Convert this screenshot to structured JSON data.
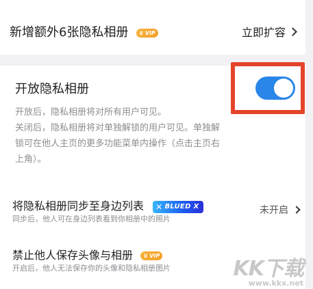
{
  "top_card": {
    "title": "新增额外6张隐私相册",
    "vip_badge": "VIP",
    "action_label": "立即扩容"
  },
  "private_album": {
    "title": "开放隐私相册",
    "toggle_on": true,
    "desc_lines": [
      "开放后，隐私相册将对所有用户可见。",
      "关闭后，隐私相册将对单独解锁的用户可见。单独解",
      "锁可在他人主页的更多功能菜单内操作（点击主页右",
      "上角）。"
    ]
  },
  "sync_row": {
    "title": "将隐私相册同步至身边列表",
    "badge": "BLUED X",
    "subtitle": "同步后，他人可在身边列表看到你相册中的照片",
    "status": "未开启"
  },
  "ban_row": {
    "title": "禁止他人保存头像与相册",
    "vip_badge": "VIP",
    "subtitle": "开启后，他人无法保存你的头像和隐私相册图片"
  },
  "watermark": {
    "logo": "KK下载",
    "url": "www.kkx.net"
  },
  "colors": {
    "toggle_on": "#2a86e8",
    "highlight_box": "#e5442a",
    "vip_badge": "#f4a02a"
  }
}
